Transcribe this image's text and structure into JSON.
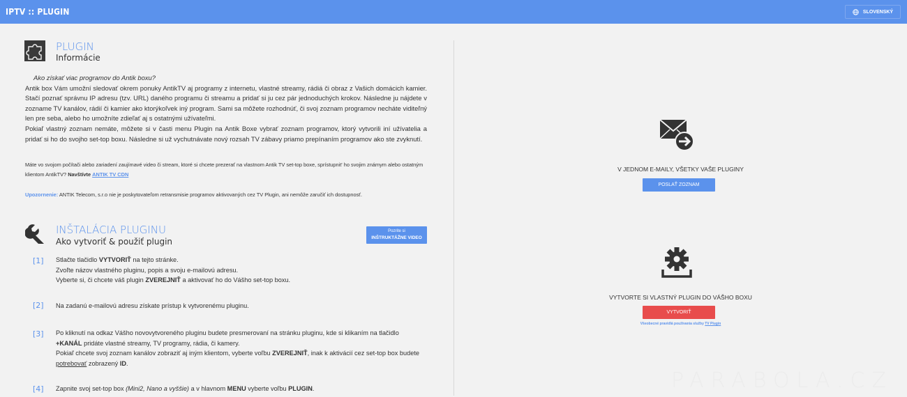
{
  "header": {
    "brand": "IPTV :: PLUGIN",
    "language_label": "SLOVENSKÝ",
    "language_icon": "globe-icon"
  },
  "plugin_section": {
    "icon": "puzzle-icon",
    "title": "PLUGIN",
    "subtitle": "Informácie",
    "question": "Ako získať viac programov do Antik boxu?",
    "paragraph1": "Antik box Vám umožní sledovať okrem ponuky AntikTV aj programy z internetu, vlastné streamy, rádiá či obraz z Vašich domácich kamier. Stačí poznať správnu IP adresu (tzv. URL) daného programu či streamu a pridať si ju cez pár jednoduchých krokov. Následne ju nájdete v zozname TV kanálov, rádií či kamier ako ktorýkoľvek iný program. Sami sa môžete rozhodnúť, či svoj zoznam programov necháte viditeľný len pre seba, alebo ho umožníte zdieľať aj s ostatnými užívateľmi.",
    "paragraph2": "Pokiaľ vlastný zoznam nemáte, môžete si v časti menu Plugin na Antik Boxe vybrať zoznam programov, ktorý vytvorili iní užívatelia a pridať si ho do svojho set-top boxu. Následne si už vychutnávate nový rozsah TV zábavy priamo prepínaním programov ako ste zvyknutí.",
    "cdn_text": "Máte vo svojom počítači alebo zariadení zaujímavé video či stream, ktoré si chcete prezerať na vlastnom Antik TV set-top boxe, sprístupnit' ho svojim známym alebo ostatným klientom AntikTV?",
    "cdn_visit": "Navštívte",
    "cdn_link": "ANTIK TV CDN",
    "warning_label": "Upozornenie:",
    "warning_text": "ANTIK Telecom, s.r.o nie je poskytovateľom retransmisie programov aktivovaných cez TV Plugin, ani nemôže zaručiť ich dostupnosť."
  },
  "install_section": {
    "icon": "wrench-icon",
    "title": "INŠTALÁCIA PLUGINU",
    "subtitle": "Ako vytvoriť & použiť plugin",
    "video_btn_top": "Pozrite si",
    "video_btn_bottom": "INŠTRUKTÁŽNE VIDEO",
    "steps": [
      {
        "num": "[1]",
        "lines": [
          "Stlačte tlačidlo",
          "VYTVORIŤ",
          "na tejto stránke.",
          "Zvoľte názov vlastného pluginu, popis a svoju e-mailovú adresu.",
          "Vyberte si, či chcete váš plugin",
          "ZVEREJNIŤ",
          "a aktivovať ho do Vášho set-top boxu."
        ]
      },
      {
        "num": "[2]",
        "lines": [
          "Na zadanú e-mailovú adresu získate prístup k vytvorenému pluginu."
        ]
      },
      {
        "num": "[3]",
        "lines": [
          "Po kliknutí na odkaz Vášho novovytvoreného pluginu budete presmerovaní na stránku pluginu, kde si klikaním na tlačidlo",
          "+KANÁL",
          "pridáte vlastné streamy, TV programy, rádia, či kamery.",
          "Pokiaľ chcete svoj zoznam kanálov zobraziť aj iným klientom, vyberte voľbu",
          "ZVEREJNIŤ",
          ", inak k aktivácií cez set-top box budete",
          "potrebovať",
          "zobrazený",
          "ID",
          "."
        ]
      },
      {
        "num": "[4]",
        "lines": [
          "Zapnite svoj set-top box",
          "(Mini2, Nano a vyššie)",
          "a v hlavnom",
          "MENU",
          "vyberte voľbu",
          "PLUGIN",
          "."
        ]
      }
    ]
  },
  "right_panel": {
    "mail_icon": "mail-send-icon",
    "mail_caption": "V JEDNOM E-MAILY, VŠETKY VAŠE PLUGINY",
    "send_btn": "POSLAŤ ZOZNAM",
    "gear_icon": "gear-install-icon",
    "create_caption": "VYTVORTE SI VLASTNÝ PLUGIN DO VÁŠHO BOXU",
    "create_btn": "VYTVORIŤ",
    "rules_text": "Všeobecné pravidlá používania služby",
    "rules_link": "TV Plugin",
    "watermark": "PARABOLA.CZ"
  },
  "colors": {
    "accent": "#5b92ec",
    "danger": "#e84c4c",
    "background": "#f2f2f2"
  }
}
